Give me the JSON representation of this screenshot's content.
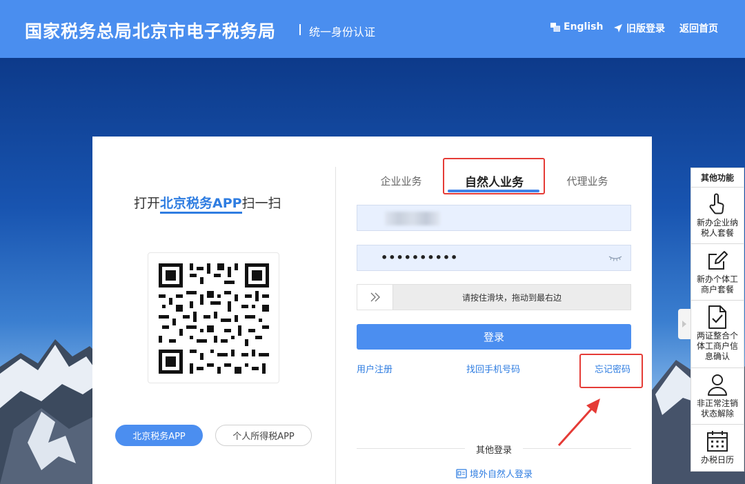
{
  "header": {
    "title": "国家税务总局北京市电子税务局",
    "subtitle": "统一身份认证",
    "nav": {
      "english": "English",
      "old_login": "旧版登录",
      "home": "返回首页"
    }
  },
  "left": {
    "scan_prefix": "打开",
    "scan_app": "北京税务APP",
    "scan_suffix": "扫一扫",
    "btn_beijing_app": "北京税务APP",
    "btn_tax_app": "个人所得税APP"
  },
  "tabs": [
    {
      "label": "企业业务"
    },
    {
      "label": "自然人业务",
      "active": true
    },
    {
      "label": "代理业务"
    }
  ],
  "form": {
    "password_mask": "••••••••••",
    "slider_hint": "请按住滑块，拖动到最右边",
    "login_label": "登录"
  },
  "links": {
    "register": "用户注册",
    "recover_phone": "找回手机号码",
    "forgot_password": "忘记密码"
  },
  "other_login": {
    "label": "其他登录",
    "overseas": "境外自然人登录"
  },
  "side_panel": {
    "title": "其他功能",
    "items": [
      {
        "label": "新办企业纳税人套餐",
        "icon": "hand-pointer-icon"
      },
      {
        "label": "新办个体工商户套餐",
        "icon": "edit-icon"
      },
      {
        "label": "两证整合个体工商户信息确认",
        "icon": "document-check-icon"
      },
      {
        "label": "非正常注销状态解除",
        "icon": "user-icon"
      },
      {
        "label": "办税日历",
        "icon": "calendar-icon"
      }
    ]
  },
  "colors": {
    "header": "#4a8eef",
    "primary": "#4b8ef0",
    "link": "#2f7de1",
    "highlight_red": "#e53b36"
  }
}
